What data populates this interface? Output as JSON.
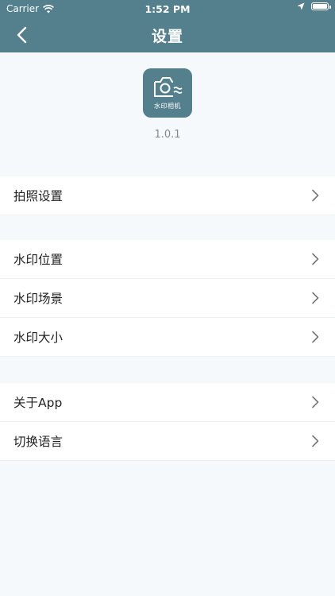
{
  "status_bar": {
    "carrier": "Carrier",
    "time": "1:52 PM"
  },
  "nav": {
    "title": "设置",
    "back_icon": "chevron-left-icon"
  },
  "app": {
    "icon_label": "水印相机",
    "version": "1.0.1",
    "icon_color": "#547f8d"
  },
  "groups": [
    {
      "items": [
        {
          "label": "拍照设置"
        }
      ]
    },
    {
      "items": [
        {
          "label": "水印位置"
        },
        {
          "label": "水印场景"
        },
        {
          "label": "水印大小"
        }
      ]
    },
    {
      "items": [
        {
          "label": "关于App"
        },
        {
          "label": "切换语言"
        }
      ]
    }
  ],
  "colors": {
    "header": "#547f8d",
    "background": "#f6f9fc",
    "row_background": "#ffffff"
  }
}
